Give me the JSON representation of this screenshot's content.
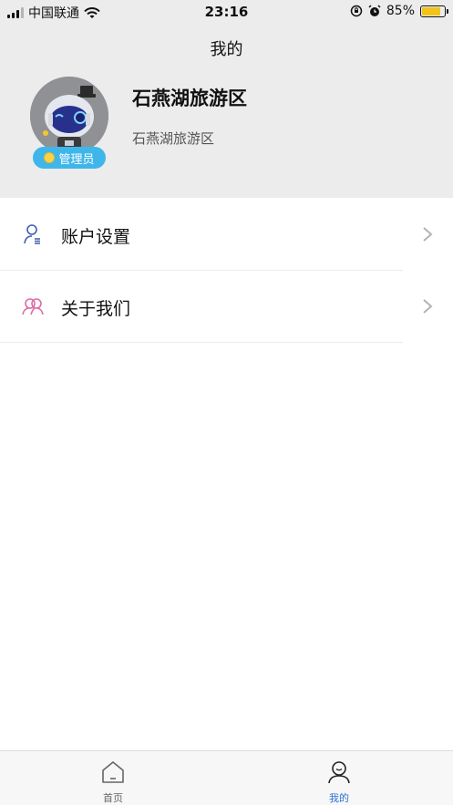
{
  "status_bar": {
    "carrier": "中国联通",
    "time": "23:16",
    "battery_percent": "85%",
    "battery_level": 0.85
  },
  "header": {
    "title": "我的"
  },
  "profile": {
    "name": "石燕湖旅游区",
    "subtitle": "石燕湖旅游区",
    "role_badge": "管理员",
    "badge_color": "#3fb6ea"
  },
  "menu": {
    "items": [
      {
        "label": "账户设置",
        "icon": "user-settings-icon",
        "icon_color": "#3d5fae"
      },
      {
        "label": "关于我们",
        "icon": "users-icon",
        "icon_color": "#e06aa6"
      }
    ]
  },
  "tab_bar": {
    "tabs": [
      {
        "label": "首页",
        "icon": "home-icon",
        "active": false
      },
      {
        "label": "我的",
        "icon": "profile-icon",
        "active": true
      }
    ],
    "active_color": "#2f6fd6"
  }
}
